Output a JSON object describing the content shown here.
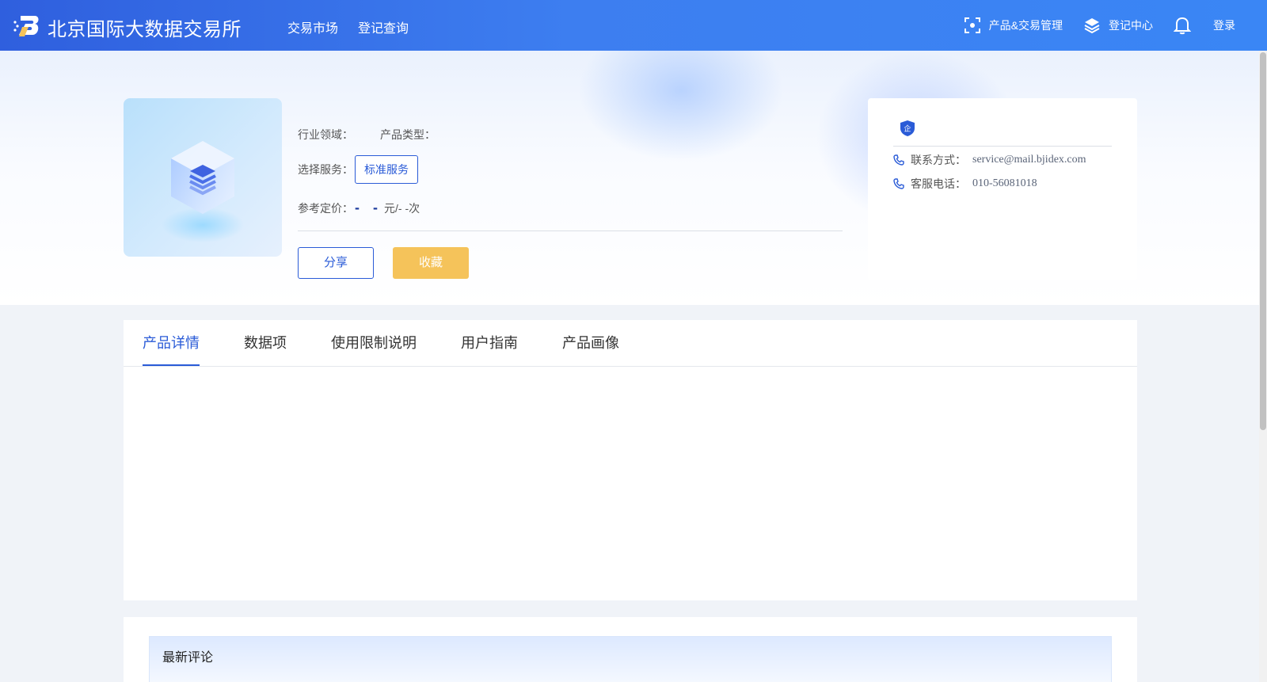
{
  "header": {
    "brand": "北京国际大数据交易所",
    "nav": [
      "交易市场",
      "登记查询"
    ],
    "right": {
      "product_mgmt": "产品&交易管理",
      "register_center": "登记中心",
      "login": "登录"
    }
  },
  "product": {
    "industry_label": "行业领域：",
    "type_label": "产品类型：",
    "service_label": "选择服务：",
    "service_option": "标准服务",
    "price_label": "参考定价：",
    "price_dashes": "- -",
    "price_unit": "元/- -次",
    "share": "分享",
    "favorite": "收藏"
  },
  "contact": {
    "badge": "企",
    "contact_label": "联系方式：",
    "contact_value": "service@mail.bjidex.com",
    "phone_label": "客服电话：",
    "phone_value": "010-56081018"
  },
  "tabs": [
    "产品详情",
    "数据项",
    "使用限制说明",
    "用户指南",
    "产品画像"
  ],
  "comments": {
    "title": "最新评论"
  },
  "colors": {
    "primary": "#2a5bd7",
    "header_start": "#2f5fde",
    "header_end": "#3a86f5",
    "favorite": "#f5c35a"
  }
}
